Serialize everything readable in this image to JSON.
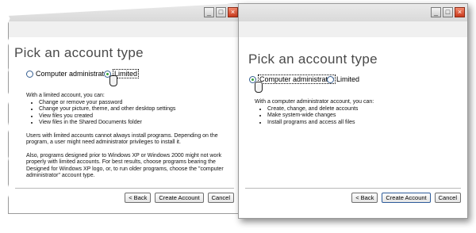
{
  "back": {
    "heading": "Pick an account type",
    "options": [
      "Computer administrator",
      "Limited"
    ],
    "selected": "Limited",
    "intro": "With a limited account, you can:",
    "bullets": [
      "Change or remove your password",
      "Change your picture, theme, and other desktop settings",
      "View files you created",
      "View files in the Shared Documents folder"
    ],
    "para1": "Users with limited accounts cannot always install programs. Depending on the program, a user might need administrator privileges to install it.",
    "para2": "Also, programs designed prior to Windows XP or Windows 2000 might not work properly with limited accounts. For best results, choose programs bearing the Designed for Windows XP logo, or, to run older programs, choose the \"computer administrator\" account type.",
    "buttons": [
      "< Back",
      "Create Account",
      "Cancel"
    ]
  },
  "front": {
    "heading": "Pick an account type",
    "options": [
      "Computer administrator",
      "Limited"
    ],
    "selected": "Computer administrator",
    "intro": "With a computer administrator account, you can:",
    "bullets": [
      "Create, change, and delete accounts",
      "Make system-wide changes",
      "Install programs and access all files"
    ],
    "buttons": [
      "< Back",
      "Create Account",
      "Cancel"
    ]
  },
  "titlebar": {
    "minimize": "_",
    "maximize": "□",
    "close": "×"
  },
  "colors": {
    "accent": "#365f91",
    "close": "#c9391c",
    "band": "#f0f0f0"
  },
  "icons": [
    "hand-cursor-icon",
    "minimize-icon",
    "maximize-icon",
    "close-icon"
  ]
}
